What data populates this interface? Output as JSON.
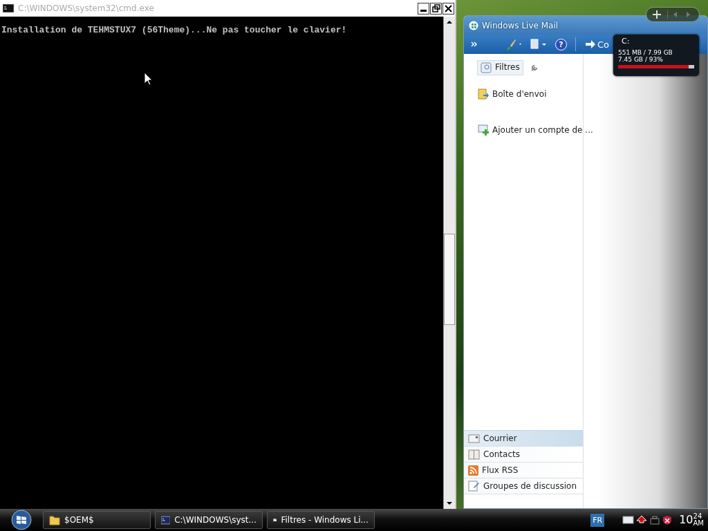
{
  "cmd_window": {
    "title": "C:\\WINDOWS\\system32\\cmd.exe",
    "lines": [
      "Installation de TEHMSTUX7 (56Theme)...Ne pas toucher le clavier!"
    ]
  },
  "mail_window": {
    "title": "Windows Live Mail",
    "help_label": "?",
    "toolbar_label": "Co",
    "folders": [
      {
        "label": "Filtres",
        "selected": true,
        "kind": "filter"
      },
      {
        "label": "Boîte d'envoi",
        "selected": false,
        "kind": "outbox"
      },
      {
        "label": "Ajouter un compte de ...",
        "selected": false,
        "kind": "add"
      }
    ],
    "nav": [
      {
        "label": "Courrier",
        "selected": true,
        "kind": "mail"
      },
      {
        "label": "Contacts",
        "selected": false,
        "kind": "contacts"
      },
      {
        "label": "Flux RSS",
        "selected": false,
        "kind": "rss"
      },
      {
        "label": "Groupes de discussion",
        "selected": false,
        "kind": "news"
      }
    ]
  },
  "drive_gadget": {
    "drive": "C:",
    "used": "551 MB / 7.99 GB",
    "free": "7.45 GB / 93%",
    "level": 0.93
  },
  "taskbar": {
    "buttons": [
      {
        "label": "$OEM$",
        "kind": "folder"
      },
      {
        "label": "C:\\WINDOWS\\syst...",
        "kind": "console"
      },
      {
        "label": "Filtres - Windows Li...",
        "kind": "mail"
      }
    ],
    "language": "FR",
    "clock": {
      "hour": "10",
      "minute": "24",
      "period": "AM"
    }
  }
}
